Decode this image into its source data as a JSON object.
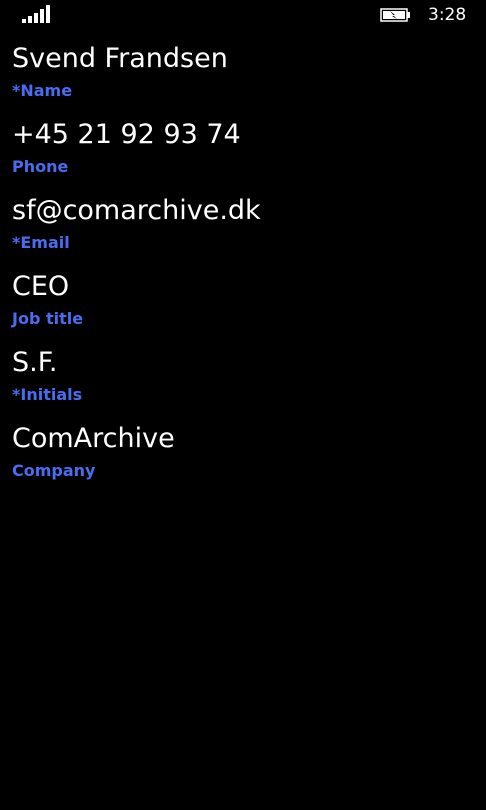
{
  "status_bar": {
    "time": "3:28",
    "signal_icon": "signal-bars-icon",
    "battery_icon": "battery-charging-icon",
    "signal_bars_filled": 5
  },
  "colors": {
    "background": "#000000",
    "value_text": "#ffffff",
    "label_accent": "#4a6cf0"
  },
  "contact": {
    "fields": [
      {
        "value": "Svend Frandsen",
        "label": "*Name"
      },
      {
        "value": "+45 21 92 93 74",
        "label": "Phone"
      },
      {
        "value": "sf@comarchive.dk",
        "label": "*Email"
      },
      {
        "value": "CEO",
        "label": "Job title"
      },
      {
        "value": "S.F.",
        "label": "*Initials"
      },
      {
        "value": "ComArchive",
        "label": "Company"
      }
    ]
  }
}
